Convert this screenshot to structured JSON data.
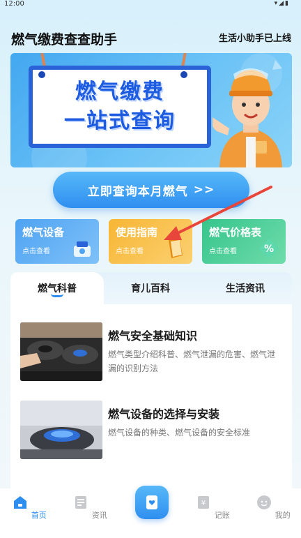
{
  "status_bar": {
    "time": "12:00",
    "icons": "▾◢▮"
  },
  "header": {
    "title": "燃气缴费查查助手",
    "slogan": "生活小助手已上线"
  },
  "banner": {
    "line1": "燃气缴费",
    "line2": "一站式查询"
  },
  "query_button": {
    "label": "立即查询本月燃气",
    "arrows": ">>"
  },
  "cards": [
    {
      "title": "燃气设备",
      "sub": "点击查看",
      "icon": "gas-stove-icon"
    },
    {
      "title": "使用指南",
      "sub": "点击查看",
      "icon": "book-icon"
    },
    {
      "title": "燃气价格表",
      "sub": "点击查看",
      "icon": "percent-tag-icon"
    }
  ],
  "tabs": [
    {
      "label": "燃气科普",
      "active": true
    },
    {
      "label": "育儿百科",
      "active": false
    },
    {
      "label": "生活资讯",
      "active": false
    }
  ],
  "articles": [
    {
      "title": "燃气安全基础知识",
      "desc": "燃气类型介绍科普、燃气泄漏的危害、燃气泄漏的识别方法"
    },
    {
      "title": "燃气设备的选择与安装",
      "desc": "燃气设备的种类、燃气设备的安全标准"
    }
  ],
  "bottom_nav": [
    {
      "label": "首页",
      "icon": "home-icon",
      "active": true
    },
    {
      "label": "资讯",
      "icon": "news-icon",
      "active": false
    },
    {
      "label": "记账",
      "icon": "ledger-icon",
      "active": false
    },
    {
      "label": "我的",
      "icon": "profile-icon",
      "active": false
    }
  ],
  "colors": {
    "primary": "#2e8ef0",
    "card_blue": "#4fa3f2",
    "card_orange": "#f7b634",
    "card_green": "#36c58c",
    "arrow_red": "#e8463a"
  }
}
